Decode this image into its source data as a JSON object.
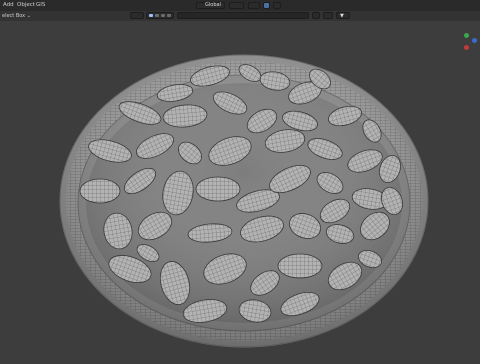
{
  "menu": {
    "items": [
      "Add",
      "Object",
      "GIS"
    ],
    "select_box": "elect Box ⌄"
  },
  "header": {
    "transform_orientation": "Global",
    "proportional": "⌄"
  },
  "gizmo": {
    "colors": {
      "green": "#3aa84a",
      "blue": "#3a6bd0",
      "red": "#c23a3a"
    }
  },
  "viewport": {
    "bg": "#3d3d3d",
    "mesh_color": "#b7b7b7"
  }
}
